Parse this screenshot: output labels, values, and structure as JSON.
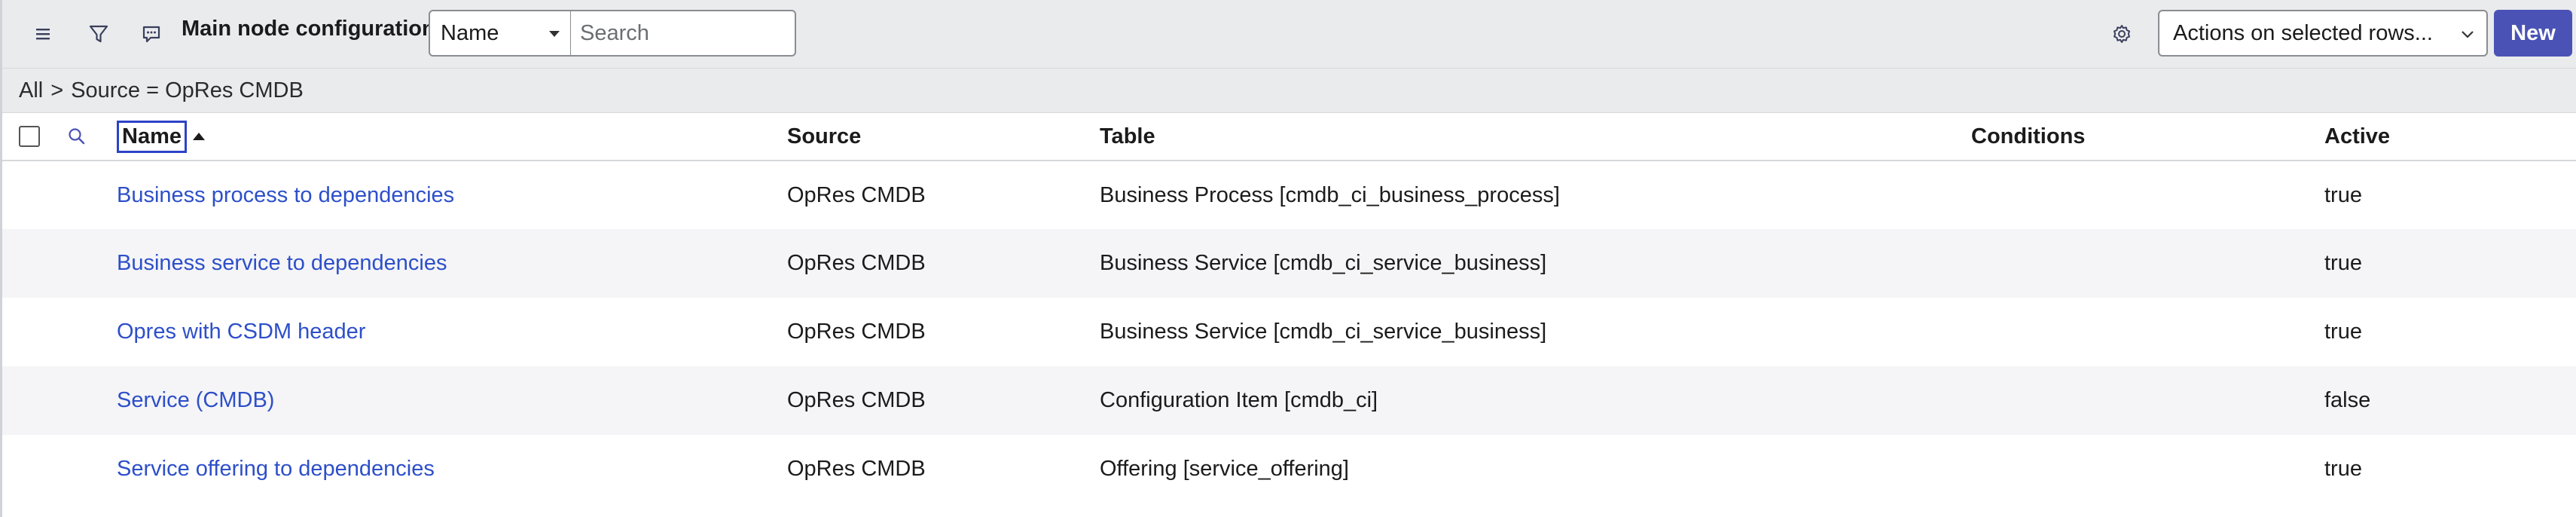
{
  "toolbar": {
    "title": "Main node configurations",
    "search_field_selected": "Name",
    "search_placeholder": "Search",
    "actions_label": "Actions on selected rows...",
    "new_label": "New"
  },
  "breadcrumb": {
    "root": "All",
    "separator": ">",
    "filter": "Source = OpRes CMDB"
  },
  "table": {
    "columns": [
      "Name",
      "Source",
      "Table",
      "Conditions",
      "Active"
    ],
    "rows": [
      {
        "name": "Business process to dependencies",
        "source": "OpRes CMDB",
        "table": "Business Process [cmdb_ci_business_process]",
        "conditions": "",
        "active": "true"
      },
      {
        "name": "Business service to dependencies",
        "source": "OpRes CMDB",
        "table": "Business Service [cmdb_ci_service_business]",
        "conditions": "",
        "active": "true"
      },
      {
        "name": "Opres with CSDM header",
        "source": "OpRes CMDB",
        "table": "Business Service [cmdb_ci_service_business]",
        "conditions": "",
        "active": "true"
      },
      {
        "name": "Service (CMDB)",
        "source": "OpRes CMDB",
        "table": "Configuration Item [cmdb_ci]",
        "conditions": "",
        "active": "false"
      },
      {
        "name": "Service offering to dependencies",
        "source": "OpRes CMDB",
        "table": "Offering [service_offering]",
        "conditions": "",
        "active": "true"
      }
    ]
  },
  "colors": {
    "toolbar_bg": "#eaebed",
    "link": "#2d4fc9",
    "primary_button": "#4a52b6"
  },
  "icons": [
    "hamburger-menu-icon",
    "filter-icon",
    "comment-icon",
    "gear-icon",
    "chevron-down-icon",
    "search-icon",
    "sort-ascending-icon"
  ]
}
